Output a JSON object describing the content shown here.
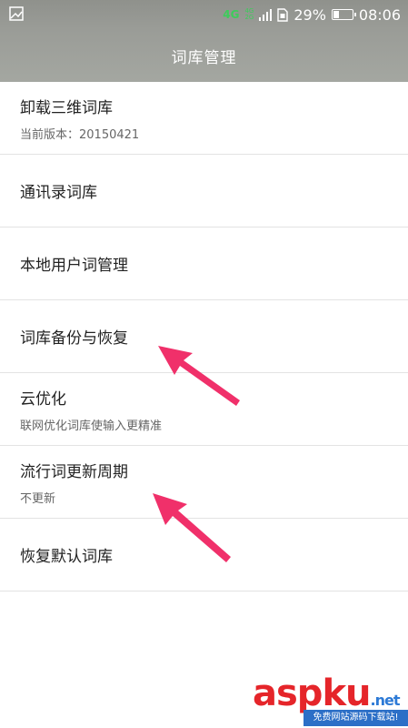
{
  "status": {
    "network": "4G",
    "network_top": "4G",
    "network_bottom": "2G",
    "network_sub": "1",
    "battery_percent_text": "29%",
    "battery_level": 0.29,
    "time": "08:06"
  },
  "header": {
    "title": "词库管理"
  },
  "items": [
    {
      "label": "卸载三维词库",
      "sub": "当前版本：20150421"
    },
    {
      "label": "通讯录词库",
      "sub": ""
    },
    {
      "label": "本地用户词管理",
      "sub": ""
    },
    {
      "label": "词库备份与恢复",
      "sub": ""
    },
    {
      "label": "云优化",
      "sub": "联网优化词库使输入更精准"
    },
    {
      "label": "流行词更新周期",
      "sub": "不更新"
    },
    {
      "label": "恢复默认词库",
      "sub": ""
    }
  ],
  "watermark": {
    "main_a": "asp",
    "main_b": "ku",
    "suffix": ".net",
    "sub": "免费网站源码下载站!"
  },
  "colors": {
    "arrow": "#f0306a",
    "header": "#9a9c97",
    "watermark_red": "#e5252a",
    "watermark_blue": "#2c6fc7"
  }
}
